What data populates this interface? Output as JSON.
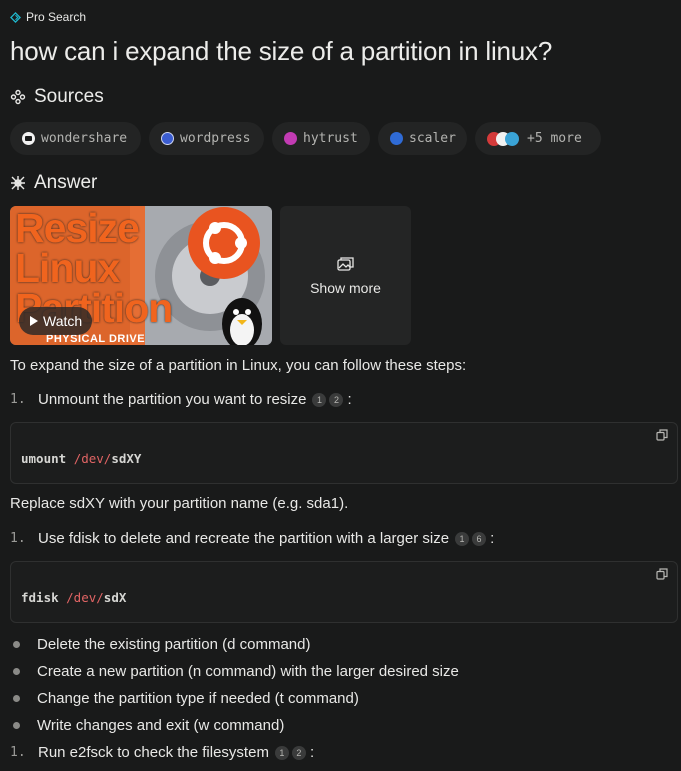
{
  "header": {
    "mode_label": "Pro Search"
  },
  "query": "how can i expand the size of a partition in linux?",
  "sources": {
    "title": "Sources",
    "chips": [
      {
        "label": "wondershare",
        "icon": "wondershare-favicon",
        "color": "#f2f2f2"
      },
      {
        "label": "wordpress",
        "icon": "wordpress-favicon",
        "color": "#3b5dd1"
      },
      {
        "label": "hytrust",
        "icon": "hytrust-favicon",
        "color": "#c23bb3"
      },
      {
        "label": "scaler",
        "icon": "scaler-favicon",
        "color": "#2f6bd6"
      },
      {
        "label": "+5 more",
        "icon": "stacked-favicons"
      }
    ]
  },
  "answer": {
    "title": "Answer",
    "thumbnail": {
      "line1": "Resize",
      "line2": "Linux",
      "line3": "Partition",
      "caption": "PHYSICAL DRIVE",
      "watch_label": "Watch"
    },
    "show_more_label": "Show more",
    "intro": "To expand the size of a partition in Linux, you can follow these steps:",
    "step1": {
      "num": "1.",
      "text": "Unmount the partition you want to resize",
      "cites": [
        "1",
        "2"
      ],
      "suffix": ":"
    },
    "code1": {
      "cmd": "umount ",
      "arg": "/dev/",
      "tail": "sdXY"
    },
    "note1": "Replace sdXY with your partition name (e.g. sda1).",
    "step2": {
      "num": "1.",
      "text": "Use fdisk to delete and recreate the partition with a larger size",
      "cites": [
        "1",
        "6"
      ],
      "suffix": ":"
    },
    "code2": {
      "cmd": "fdisk ",
      "arg": "/dev/",
      "tail": "sdX"
    },
    "bullets": [
      "Delete the existing partition (d command)",
      "Create a new partition (n command) with the larger desired size",
      "Change the partition type if needed (t command)",
      "Write changes and exit (w command)"
    ],
    "step3": {
      "num": "1.",
      "text": "Run e2fsck to check the filesystem",
      "cites": [
        "1",
        "2"
      ],
      "suffix": ":"
    }
  },
  "colors": {
    "background": "#191a1a",
    "accent": "#20b8cd",
    "code_path": "#e06464",
    "thumb_orange": "#f0641e"
  }
}
